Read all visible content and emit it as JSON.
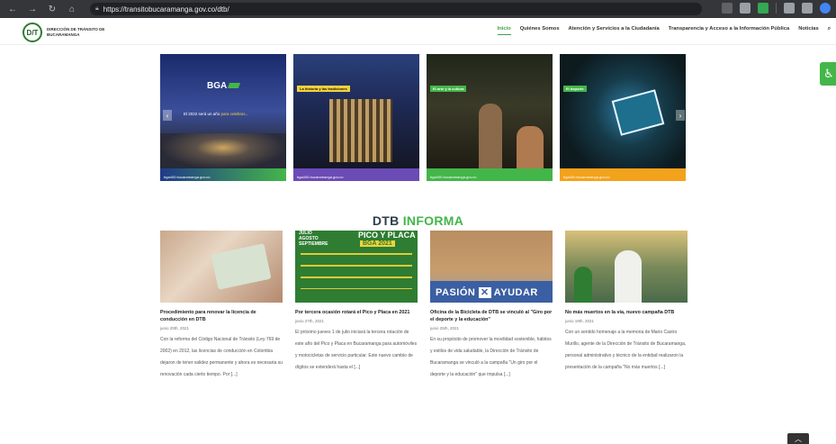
{
  "browser": {
    "url": "https://transitobucaramanga.gov.co/dtb/"
  },
  "site": {
    "logo_initials": "D/T",
    "logo_text": "DIRECCIÓN DE TRÁNSITO DE BUCARAMANGA",
    "menu": [
      "Inicio",
      "Quiénes Somos",
      "Atención y Servicios a la Ciudadanía",
      "Transparencia y Acceso a la Información Pública",
      "Noticias"
    ]
  },
  "slides": [
    {
      "brand": "BGA",
      "caption": "El 2022 será un año",
      "caption_highlight": "para celebrar",
      "footer": "bga400.bucaramanga.gov.co",
      "color": "#1f3a8a"
    },
    {
      "label": "La historia y las tradiciones",
      "footer": "bga400.bucaramanga.gov.co",
      "color": "#6b4bb5"
    },
    {
      "label": "El arte y la cultura",
      "footer": "bga400.bucaramanga.gov.co",
      "color": "#43b649"
    },
    {
      "label": "El deporte",
      "footer": "bga400.bucaramanga.gov.co",
      "color": "#f3a21b"
    }
  ],
  "section": {
    "title_a": "DTB",
    "title_b": "INFORMA"
  },
  "posts": [
    {
      "title": "Procedimiento para renovar la licencia de conducción en DTB",
      "date": "junio 29th, 2021",
      "excerpt": "Con la reforma del Código Nacional de Tránsito (Ley 769 de 2002) en 2012, las licencias de conducción en Colombia dejaron de tener validez permanente y ahora es necesaria su renovación cada cierto tiempo. Por [...]"
    },
    {
      "title": "Por tercera ocasión rotará el Pico y Placa en 2021",
      "date": "junio 27th, 2021",
      "excerpt": "El próximo jueves 1 de julio iniciará la tercera rotación de este año del Pico y Placa en Bucaramanga para automóviles y motocicletas de servicio particular. Este nuevo cambio de dígitos se extenderá hasta el [...]",
      "img_line1": "JULIO",
      "img_line2": "AGOSTO",
      "img_line3": "SEPTIEMBRE",
      "img_title": "PICO Y PLACA",
      "img_badge": "BGA 2021"
    },
    {
      "title": "Oficina de la Bicicleta de DTB se vinculó al \"Giro por el deporte y la educación\"",
      "date": "junio 25th, 2021",
      "excerpt": "En su propósito de promover la movilidad sostenible, hábitos y estilos de vida saludable, la Dirección de Tránsito de Bucaramanga se vinculó a la campaña \"Un giro por el deporte y la educación\" que impulsa [...]",
      "img_text_a": "PASIÓN",
      "img_text_b": "AYUDAR"
    },
    {
      "title": "No más muertos en la vía, nuevo campaña DTB",
      "date": "junio 19th, 2021",
      "excerpt": "Con un sentido homenaje a la memoria de Mario Castro Murillo, agente de la Dirección de Tránsito de Bucaramanga, personal administrativo y técnico de la entidad realizaron la presentación de la campaña \"No más muertos [...]"
    }
  ]
}
